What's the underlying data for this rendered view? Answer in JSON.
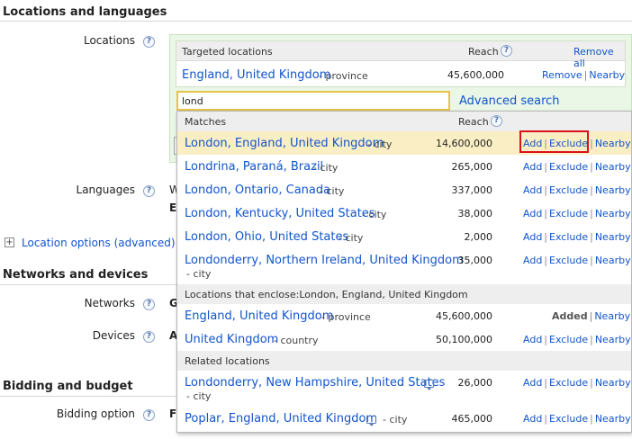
{
  "sections": {
    "locations_languages": "Locations and languages",
    "networks_devices": "Networks and devices",
    "bidding_budget": "Bidding and budget"
  },
  "fields": {
    "locations": "Locations",
    "languages": "Languages",
    "location_options": "Location options (advanced)",
    "networks": "Networks",
    "devices": "Devices",
    "bidding_option": "Bidding option"
  },
  "clipped_values": {
    "languages_line1": "W",
    "languages_line2": "E",
    "networks": "G",
    "devices": "A",
    "bidding": "F"
  },
  "icons": {
    "help": "question-mark-circle-icon",
    "expand": "plus-box-icon",
    "comment": "speech-bubble-icon"
  },
  "colors": {
    "link": "#1155cc",
    "panel_bg": "#eaf6e6",
    "highlight_row": "#faeec4",
    "search_border": "#e6c44a",
    "annotation_red": "#d9121b"
  },
  "targeted": {
    "header": "Targeted locations",
    "reach_header": "Reach",
    "remove_all": "Remove all",
    "item": {
      "name": "England, United Kingdom",
      "type": "- province",
      "reach": "45,600,000",
      "remove": "Remove",
      "nearby": "Nearby"
    }
  },
  "search": {
    "value": "lond",
    "advanced": "Advanced search"
  },
  "dropdown": {
    "matches_header": "Matches",
    "reach_header": "Reach",
    "enclose_header": "Locations that enclose:London, England, United Kingdom",
    "related_header": "Related locations",
    "add": "Add",
    "exclude": "Exclude",
    "nearby": "Nearby",
    "added": "Added",
    "matches": [
      {
        "name": "London, England, United Kingdom",
        "type": "- city",
        "reach": "14,600,000"
      },
      {
        "name": "Londrina, Paraná, Brazil",
        "type": "- city",
        "reach": "265,000"
      },
      {
        "name": "London, Ontario, Canada",
        "type": "- city",
        "reach": "337,000"
      },
      {
        "name": "London, Kentucky, United States",
        "type": "- city",
        "reach": "38,000"
      },
      {
        "name": "London, Ohio, United States",
        "type": "- city",
        "reach": "2,000"
      },
      {
        "name": "Londonderry, Northern Ireland, United Kingdom",
        "type": "- city",
        "reach": "35,000"
      }
    ],
    "enclosing": [
      {
        "name": "England, United Kingdom",
        "type": "- province",
        "reach": "45,600,000"
      },
      {
        "name": "United Kingdom",
        "type": "- country",
        "reach": "50,100,000"
      }
    ],
    "related": [
      {
        "name": "Londonderry, New Hampshire, United States",
        "type": "- city",
        "reach": "26,000"
      },
      {
        "name": "Poplar, England, United Kingdom",
        "type": "- city",
        "reach": "465,000"
      }
    ]
  }
}
